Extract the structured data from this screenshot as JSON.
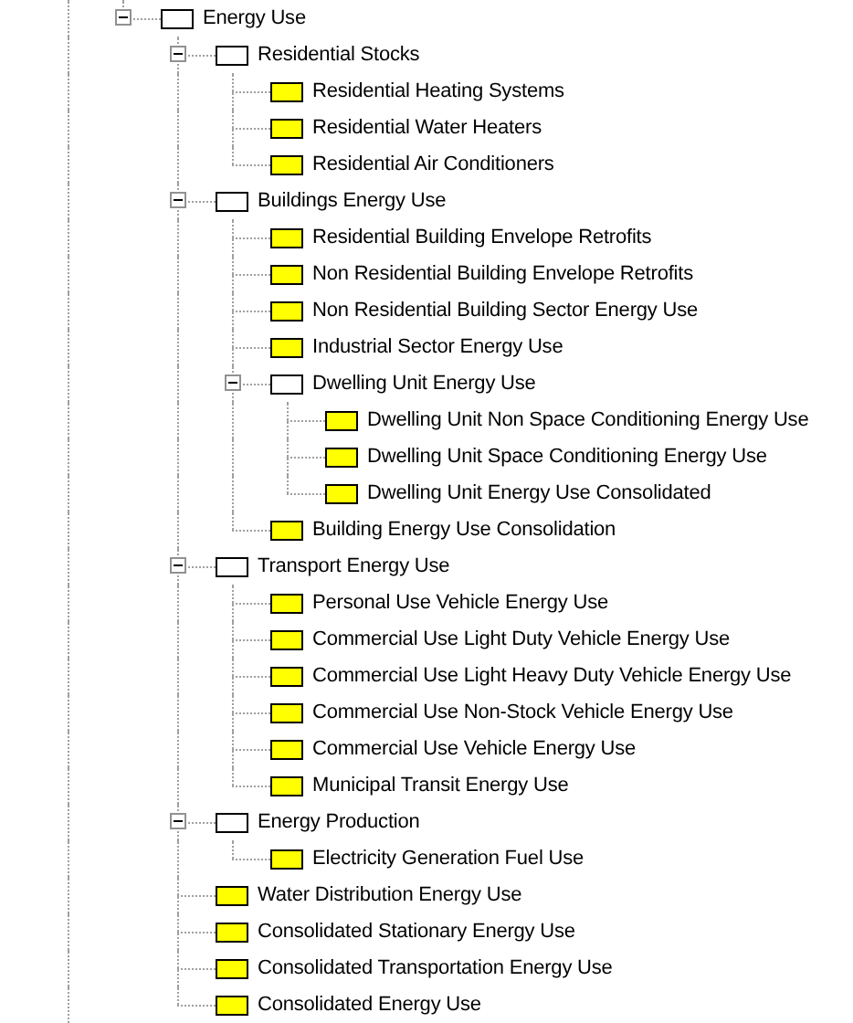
{
  "tree": [
    {
      "label": "Energy Use",
      "color": "#ffffff",
      "expanded": true,
      "children": [
        {
          "label": "Residential Stocks",
          "color": "#ffffff",
          "expanded": true,
          "children": [
            {
              "label": "Residential Heating Systems",
              "color": "#ffff00"
            },
            {
              "label": "Residential Water Heaters",
              "color": "#ffff00"
            },
            {
              "label": "Residential Air Conditioners",
              "color": "#ffff00"
            }
          ]
        },
        {
          "label": "Buildings Energy Use",
          "color": "#ffffff",
          "expanded": true,
          "children": [
            {
              "label": "Residential Building Envelope Retrofits",
              "color": "#ffff00"
            },
            {
              "label": "Non Residential Building Envelope Retrofits",
              "color": "#ffff00"
            },
            {
              "label": "Non Residential Building Sector Energy Use",
              "color": "#ffff00"
            },
            {
              "label": "Industrial Sector Energy Use",
              "color": "#ffff00"
            },
            {
              "label": "Dwelling Unit Energy Use",
              "color": "#ffffff",
              "expanded": true,
              "children": [
                {
                  "label": "Dwelling Unit Non Space Conditioning Energy Use",
                  "color": "#ffff00"
                },
                {
                  "label": "Dwelling Unit Space Conditioning Energy Use",
                  "color": "#ffff00"
                },
                {
                  "label": "Dwelling Unit Energy Use Consolidated",
                  "color": "#ffff00"
                }
              ]
            },
            {
              "label": "Building Energy Use Consolidation",
              "color": "#ffff00"
            }
          ]
        },
        {
          "label": "Transport Energy Use",
          "color": "#ffffff",
          "expanded": true,
          "children": [
            {
              "label": "Personal Use Vehicle Energy Use",
              "color": "#ffff00"
            },
            {
              "label": "Commercial Use Light Duty Vehicle Energy Use",
              "color": "#ffff00"
            },
            {
              "label": "Commercial Use Light Heavy Duty Vehicle Energy Use",
              "color": "#ffff00"
            },
            {
              "label": "Commercial Use Non-Stock Vehicle Energy Use",
              "color": "#ffff00"
            },
            {
              "label": "Commercial Use Vehicle Energy Use",
              "color": "#ffff00"
            },
            {
              "label": "Municipal Transit Energy Use",
              "color": "#ffff00"
            }
          ]
        },
        {
          "label": "Energy Production",
          "color": "#ffffff",
          "expanded": true,
          "children": [
            {
              "label": "Electricity Generation Fuel Use",
              "color": "#ffff00"
            }
          ]
        },
        {
          "label": "Water Distribution Energy Use",
          "color": "#ffff00"
        },
        {
          "label": "Consolidated Stationary Energy Use",
          "color": "#ffff00"
        },
        {
          "label": "Consolidated Transportation Energy Use",
          "color": "#ffff00"
        },
        {
          "label": "Consolidated Energy Use",
          "color": "#ffff00"
        }
      ]
    }
  ]
}
